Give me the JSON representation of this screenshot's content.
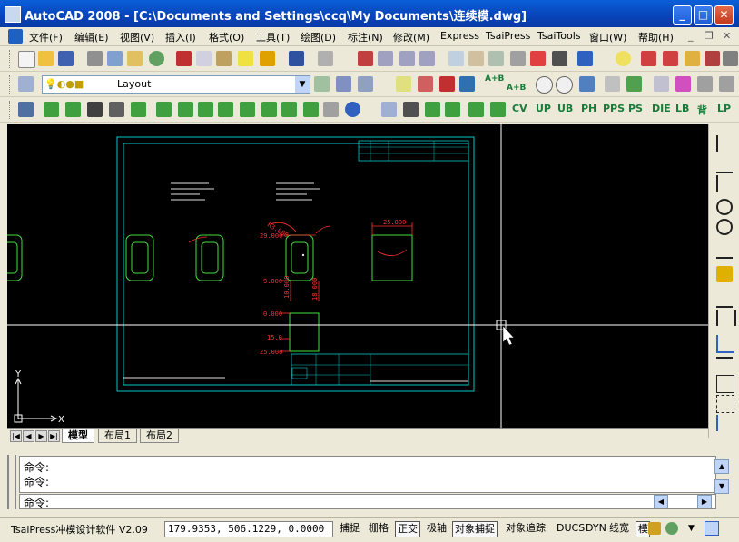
{
  "window": {
    "title": "AutoCAD 2008 - [C:\\Documents and Settings\\ccq\\My Documents\\连续模.dwg]",
    "controls": [
      "minimize",
      "maximize",
      "close"
    ]
  },
  "menu": {
    "items": [
      "文件(F)",
      "编辑(E)",
      "视图(V)",
      "插入(I)",
      "格式(O)",
      "工具(T)",
      "绘图(D)",
      "标注(N)",
      "修改(M)",
      "Express",
      "TsaiPress",
      "TsaiTools",
      "窗口(W)",
      "帮助(H)"
    ],
    "doc_controls": [
      "minimize",
      "restore",
      "close"
    ]
  },
  "toolbar2": {
    "layer_value": "Layout"
  },
  "toolbar3": {
    "right_labels": [
      "UP",
      "UB",
      "PH",
      "PPS",
      "PS",
      "DIE",
      "LB",
      "背",
      "LP"
    ],
    "left_labels": [
      "A+B",
      "A+B"
    ]
  },
  "toolbar4": {
    "labels": [
      "CV",
      "UP",
      "UB",
      "PH",
      "PPS",
      "PS",
      "DIE",
      "LB",
      "背",
      "LP"
    ]
  },
  "drawing": {
    "dimensions": [
      "29.000",
      "9.000",
      "0.000",
      "15.0",
      "25.000",
      "25.000",
      "10.000",
      "18.000",
      "R3.000"
    ],
    "ucs_x": "X",
    "ucs_y": "Y"
  },
  "tabs": {
    "items": [
      "模型",
      "布局1",
      "布局2"
    ],
    "active": "模型"
  },
  "command": {
    "history": [
      "命令:",
      "命令:"
    ],
    "prompt": "命令:"
  },
  "status": {
    "app_label": "TsaiPress冲模设计软件 V2.09",
    "coordinates": "179.9353, 506.1229, 0.0000",
    "toggles": [
      {
        "label": "捕捉",
        "on": false
      },
      {
        "label": "栅格",
        "on": false
      },
      {
        "label": "正交",
        "on": true
      },
      {
        "label": "极轴",
        "on": false
      },
      {
        "label": "对象捕捉",
        "on": true
      },
      {
        "label": "对象追踪",
        "on": false
      },
      {
        "label": "DUCS",
        "on": false
      },
      {
        "label": "DYN",
        "on": false
      },
      {
        "label": "线宽",
        "on": false
      },
      {
        "label": "模型",
        "on": true
      }
    ]
  },
  "colors": {
    "titlebar": "#0a3aa6",
    "canvas": "#000000",
    "frame": "#00c8c8",
    "part": "#40e040",
    "dimension": "#ff3030",
    "crosshair": "#ffffff"
  }
}
